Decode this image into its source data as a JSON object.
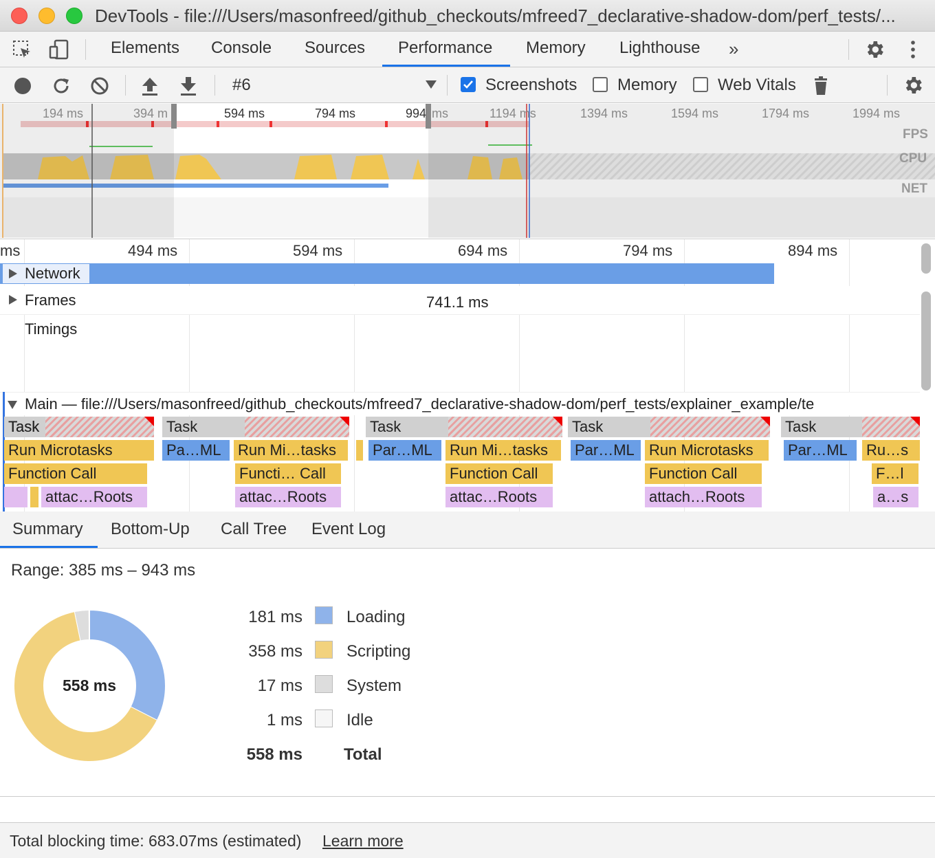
{
  "window": {
    "title": "DevTools - file:///Users/masonfreed/github_checkouts/mfreed7_declarative-shadow-dom/perf_tests/..."
  },
  "tabs": [
    {
      "label": "Elements"
    },
    {
      "label": "Console"
    },
    {
      "label": "Sources"
    },
    {
      "label": "Performance",
      "selected": true
    },
    {
      "label": "Memory"
    },
    {
      "label": "Lighthouse"
    }
  ],
  "toolbar": {
    "recording_select": "#6",
    "screenshots_label": "Screenshots",
    "screenshots_checked": true,
    "memory_label": "Memory",
    "memory_checked": false,
    "web_vitals_label": "Web Vitals",
    "web_vitals_checked": false
  },
  "overview": {
    "ticks": [
      "194 ms",
      "394 m",
      "594 ms",
      "794 ms",
      "994",
      "ms",
      "1194 ms",
      "1394 ms",
      "1594 ms",
      "1794 ms",
      "1994 ms"
    ],
    "labels": {
      "fps": "FPS",
      "cpu": "CPU",
      "net": "NET"
    }
  },
  "flame": {
    "ticks": [
      "ms",
      "494 ms",
      "594 ms",
      "694 ms",
      "794 ms",
      "894 ms"
    ],
    "tracks": {
      "network": "Network",
      "frames": "Frames",
      "frame_duration": "741.1 ms",
      "timings": "Timings",
      "main": "Main — file:///Users/masonfreed/github_checkouts/mfreed7_declarative-shadow-dom/perf_tests/explainer_example/te"
    },
    "labels": {
      "task": "Task",
      "run_microtasks": "Run Microtasks",
      "run_mi_tasks": "Run Mi…tasks",
      "ru_s": "Ru…s",
      "pa_ml": "Pa…ML",
      "par_ml": "Par…ML",
      "function_call": "Function Call",
      "functi_call": "Functi… Call",
      "f_l": "F…l",
      "attac_roots": "attac…Roots",
      "attach_roots": "attach…Roots",
      "a_s": "a…s"
    }
  },
  "bottom_tabs": [
    {
      "label": "Summary",
      "selected": true
    },
    {
      "label": "Bottom-Up"
    },
    {
      "label": "Call Tree"
    },
    {
      "label": "Event Log"
    }
  ],
  "summary": {
    "range": "Range: 385 ms – 943 ms",
    "total_center": "558 ms",
    "rows": [
      {
        "value": "181 ms",
        "label": "Loading",
        "color": "#8fb3ea",
        "ms": 181
      },
      {
        "value": "358 ms",
        "label": "Scripting",
        "color": "#f2d27e",
        "ms": 358
      },
      {
        "value": "17 ms",
        "label": "System",
        "color": "#dddddd",
        "ms": 17
      },
      {
        "value": "1 ms",
        "label": "Idle",
        "color": "#f6f6f6",
        "ms": 1
      }
    ],
    "total": {
      "value": "558 ms",
      "label": "Total"
    }
  },
  "footer": {
    "blocking_text": "Total blocking time: 683.07ms (estimated)",
    "learn_more": "Learn more"
  }
}
